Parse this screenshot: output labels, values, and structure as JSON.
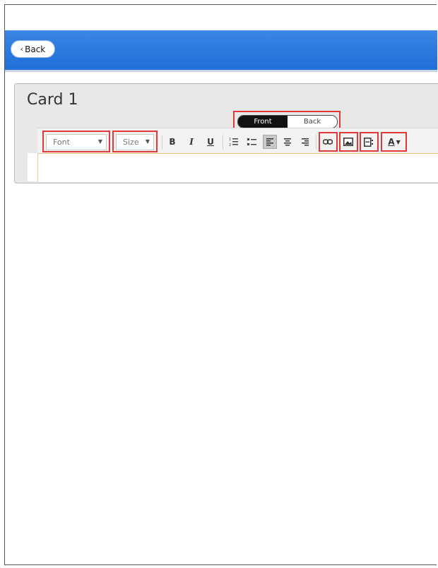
{
  "nav": {
    "back_label": "Back",
    "back_icon": "chevron-left-icon"
  },
  "card": {
    "title": "Card 1"
  },
  "side_toggle": {
    "front_label": "Front",
    "back_label": "Back",
    "selected": "Front"
  },
  "toolbar": {
    "font_placeholder": "Font",
    "size_placeholder": "Size",
    "bold": "B",
    "italic": "I",
    "underline": "U",
    "text_color_label": "A"
  },
  "colors": {
    "nav_blue": "#2a7be0",
    "highlight_red": "#e23a3a",
    "editor_border": "#f0c580"
  }
}
